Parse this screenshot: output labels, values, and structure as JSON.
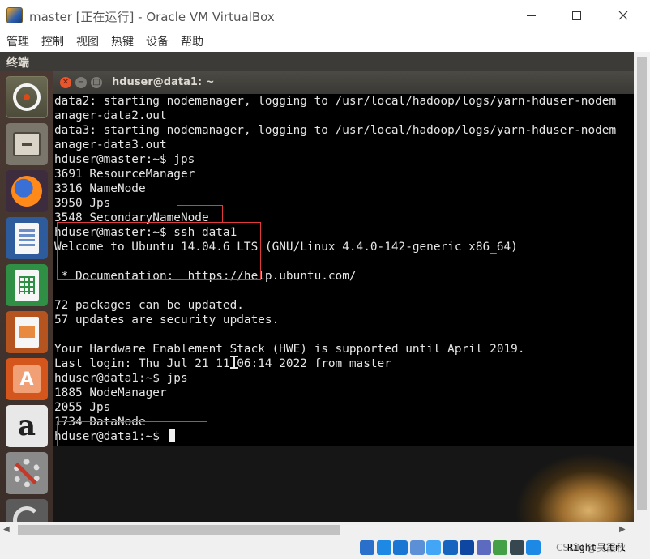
{
  "window": {
    "title": "master [正在运行] - Oracle VM VirtualBox",
    "menu": [
      "管理",
      "控制",
      "视图",
      "热键",
      "设备",
      "帮助"
    ]
  },
  "guest": {
    "topbar_label": "终端",
    "launcher": [
      {
        "name": "dash-home",
        "icon": "ubuntu-logo"
      },
      {
        "name": "files",
        "icon": "file-cabinet"
      },
      {
        "name": "firefox",
        "icon": "firefox-logo"
      },
      {
        "name": "libreoffice-writer",
        "icon": "writer-document"
      },
      {
        "name": "libreoffice-calc",
        "icon": "calc-spreadsheet"
      },
      {
        "name": "libreoffice-impress",
        "icon": "impress-presentation"
      },
      {
        "name": "ubuntu-software-center",
        "icon": "shopping-bag"
      },
      {
        "name": "amazon",
        "icon": "amazon-logo"
      },
      {
        "name": "system-settings",
        "icon": "wrench-gear"
      },
      {
        "name": "software-updater",
        "icon": "update-arrow"
      }
    ]
  },
  "terminal": {
    "title": "hduser@data1: ~",
    "lines": [
      "data2: starting nodemanager, logging to /usr/local/hadoop/logs/yarn-hduser-nodem",
      "anager-data2.out",
      "data3: starting nodemanager, logging to /usr/local/hadoop/logs/yarn-hduser-nodem",
      "anager-data3.out",
      "hduser@master:~$ jps",
      "3691 ResourceManager",
      "3316 NameNode",
      "3950 Jps",
      "3548 SecondaryNameNode",
      "hduser@master:~$ ssh data1",
      "Welcome to Ubuntu 14.04.6 LTS (GNU/Linux 4.4.0-142-generic x86_64)",
      "",
      " * Documentation:  https://help.ubuntu.com/",
      "",
      "72 packages can be updated.",
      "57 updates are security updates.",
      "",
      "Your Hardware Enablement Stack (HWE) is supported until April 2019.",
      "Last login: Thu Jul 21 11:06:14 2022 from master",
      "hduser@data1:~$ jps",
      "1885 NodeManager",
      "2055 Jps",
      "1734 DataNode",
      "hduser@data1:~$ "
    ]
  },
  "status": {
    "host_key": "Right Ctrl",
    "watermark": "CSDN @吴霞秋",
    "icon_colors": [
      "#2a6fc9",
      "#1e88e5",
      "#1976d2",
      "#5b8fd6",
      "#42a5f5",
      "#1565c0",
      "#0d47a1",
      "#5c6bc0",
      "#43a047",
      "#37474f",
      "#1e88e5"
    ]
  }
}
